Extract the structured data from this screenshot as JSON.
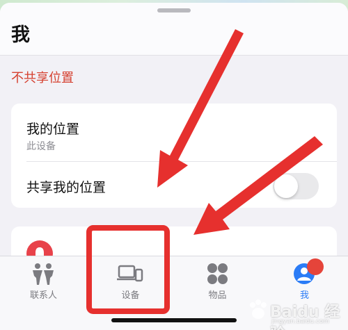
{
  "header": {
    "title": "我"
  },
  "section": {
    "label": "不共享位置"
  },
  "location_card": {
    "title": "我的位置",
    "subtitle": "此设备",
    "share_label": "共享我的位置",
    "share_enabled": false
  },
  "tabs": [
    {
      "label": "联系人",
      "icon": "people-icon",
      "active": false
    },
    {
      "label": "设备",
      "icon": "devices-icon",
      "active": false
    },
    {
      "label": "物品",
      "icon": "items-icon",
      "active": false
    },
    {
      "label": "我",
      "icon": "me-icon",
      "active": true
    }
  ],
  "colors": {
    "accent": "#2b7cf6",
    "section_label": "#d5402f",
    "annotation": "#e6302e"
  },
  "watermark": {
    "text": "Baidu 经验",
    "url": "jingyan.baidu.com"
  }
}
